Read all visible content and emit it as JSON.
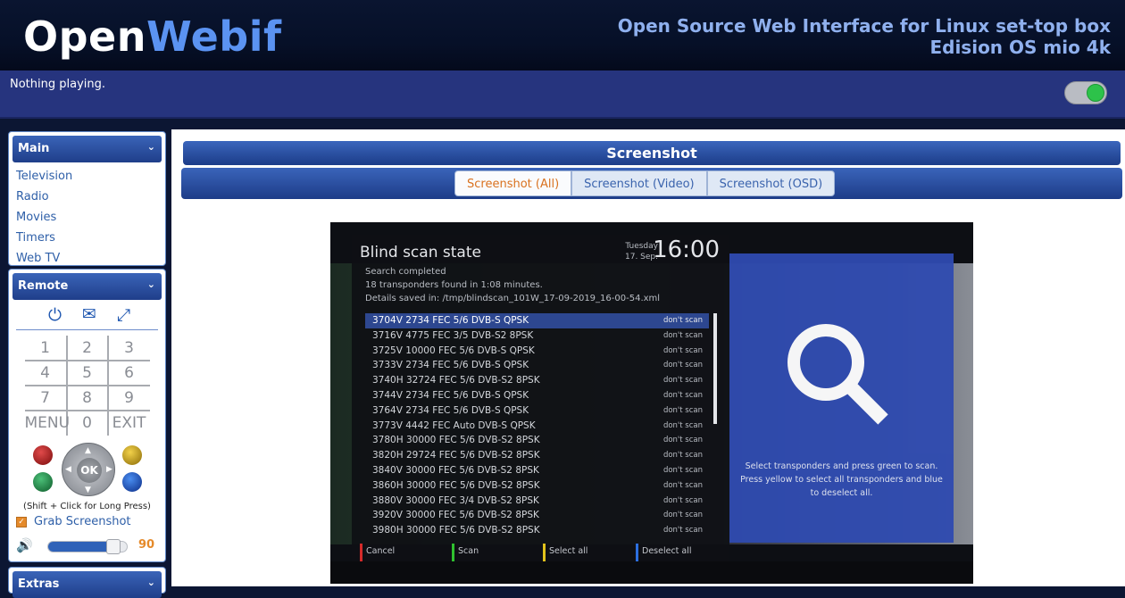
{
  "header": {
    "logo_part1": "Open",
    "logo_part2": "Webif",
    "tagline_line1": "Open Source Web Interface for Linux set-top box",
    "tagline_line2": "Edision OS mio 4k"
  },
  "status": {
    "now_playing": "Nothing playing."
  },
  "sidebar": {
    "main_title": "Main",
    "main_items": [
      {
        "label": "Television"
      },
      {
        "label": "Radio"
      },
      {
        "label": "Movies"
      },
      {
        "label": "Timers"
      },
      {
        "label": "Web TV"
      }
    ],
    "remote_title": "Remote",
    "keys": [
      "1",
      "2",
      "3",
      "4",
      "5",
      "6",
      "7",
      "8",
      "9",
      "MENU",
      "0",
      "EXIT"
    ],
    "ok_label": "OK",
    "longpress_hint": "(Shift + Click for Long Press)",
    "grab_label": "Grab Screenshot",
    "volume_value": "90",
    "volume_level": 0.9,
    "extras_title": "Extras"
  },
  "main": {
    "title": "Screenshot",
    "tabs": [
      {
        "label": "Screenshot (All)",
        "active": true
      },
      {
        "label": "Screenshot (Video)",
        "active": false
      },
      {
        "label": "Screenshot (OSD)",
        "active": false
      }
    ]
  },
  "screenshot": {
    "osd_title": "Blind scan state",
    "day": "Tuesday",
    "date": "17. Sep.",
    "time": "16:00",
    "info1": "Search completed",
    "info2": "18 transponders found in 1:08 minutes.",
    "info3": "Details saved in: /tmp/blindscan_101W_17-09-2019_16-00-54.xml",
    "rows": [
      {
        "label": "3704V 2734 FEC 5/6 DVB-S QPSK",
        "state": "don't scan"
      },
      {
        "label": "3716V 4775 FEC 3/5 DVB-S2 8PSK",
        "state": "don't scan"
      },
      {
        "label": "3725V 10000 FEC 5/6 DVB-S QPSK",
        "state": "don't scan"
      },
      {
        "label": "3733V 2734 FEC 5/6 DVB-S QPSK",
        "state": "don't scan"
      },
      {
        "label": "3740H 32724 FEC 5/6 DVB-S2 8PSK",
        "state": "don't scan"
      },
      {
        "label": "3744V 2734 FEC 5/6 DVB-S QPSK",
        "state": "don't scan"
      },
      {
        "label": "3764V 2734 FEC 5/6 DVB-S QPSK",
        "state": "don't scan"
      },
      {
        "label": "3773V 4442 FEC Auto DVB-S QPSK",
        "state": "don't scan"
      },
      {
        "label": "3780H 30000 FEC 5/6 DVB-S2 8PSK",
        "state": "don't scan"
      },
      {
        "label": "3820H 29724 FEC 5/6 DVB-S2 8PSK",
        "state": "don't scan"
      },
      {
        "label": "3840V 30000 FEC 5/6 DVB-S2 8PSK",
        "state": "don't scan"
      },
      {
        "label": "3860H 30000 FEC 5/6 DVB-S2 8PSK",
        "state": "don't scan"
      },
      {
        "label": "3880V 30000 FEC 3/4 DVB-S2 8PSK",
        "state": "don't scan"
      },
      {
        "label": "3920V 30000 FEC 5/6 DVB-S2 8PSK",
        "state": "don't scan"
      },
      {
        "label": "3980H 30000 FEC 5/6 DVB-S2 8PSK",
        "state": "don't scan"
      }
    ],
    "footer_keys": [
      {
        "label": "Cancel",
        "color": "#d42a2a"
      },
      {
        "label": "Scan",
        "color": "#2fc12f"
      },
      {
        "label": "Select all",
        "color": "#e2c21c"
      },
      {
        "label": "Deselect all",
        "color": "#2c6fe0"
      }
    ],
    "search_hint": "Select transponders and press green to scan. Press yellow to select all transponders and blue to deselect all."
  }
}
